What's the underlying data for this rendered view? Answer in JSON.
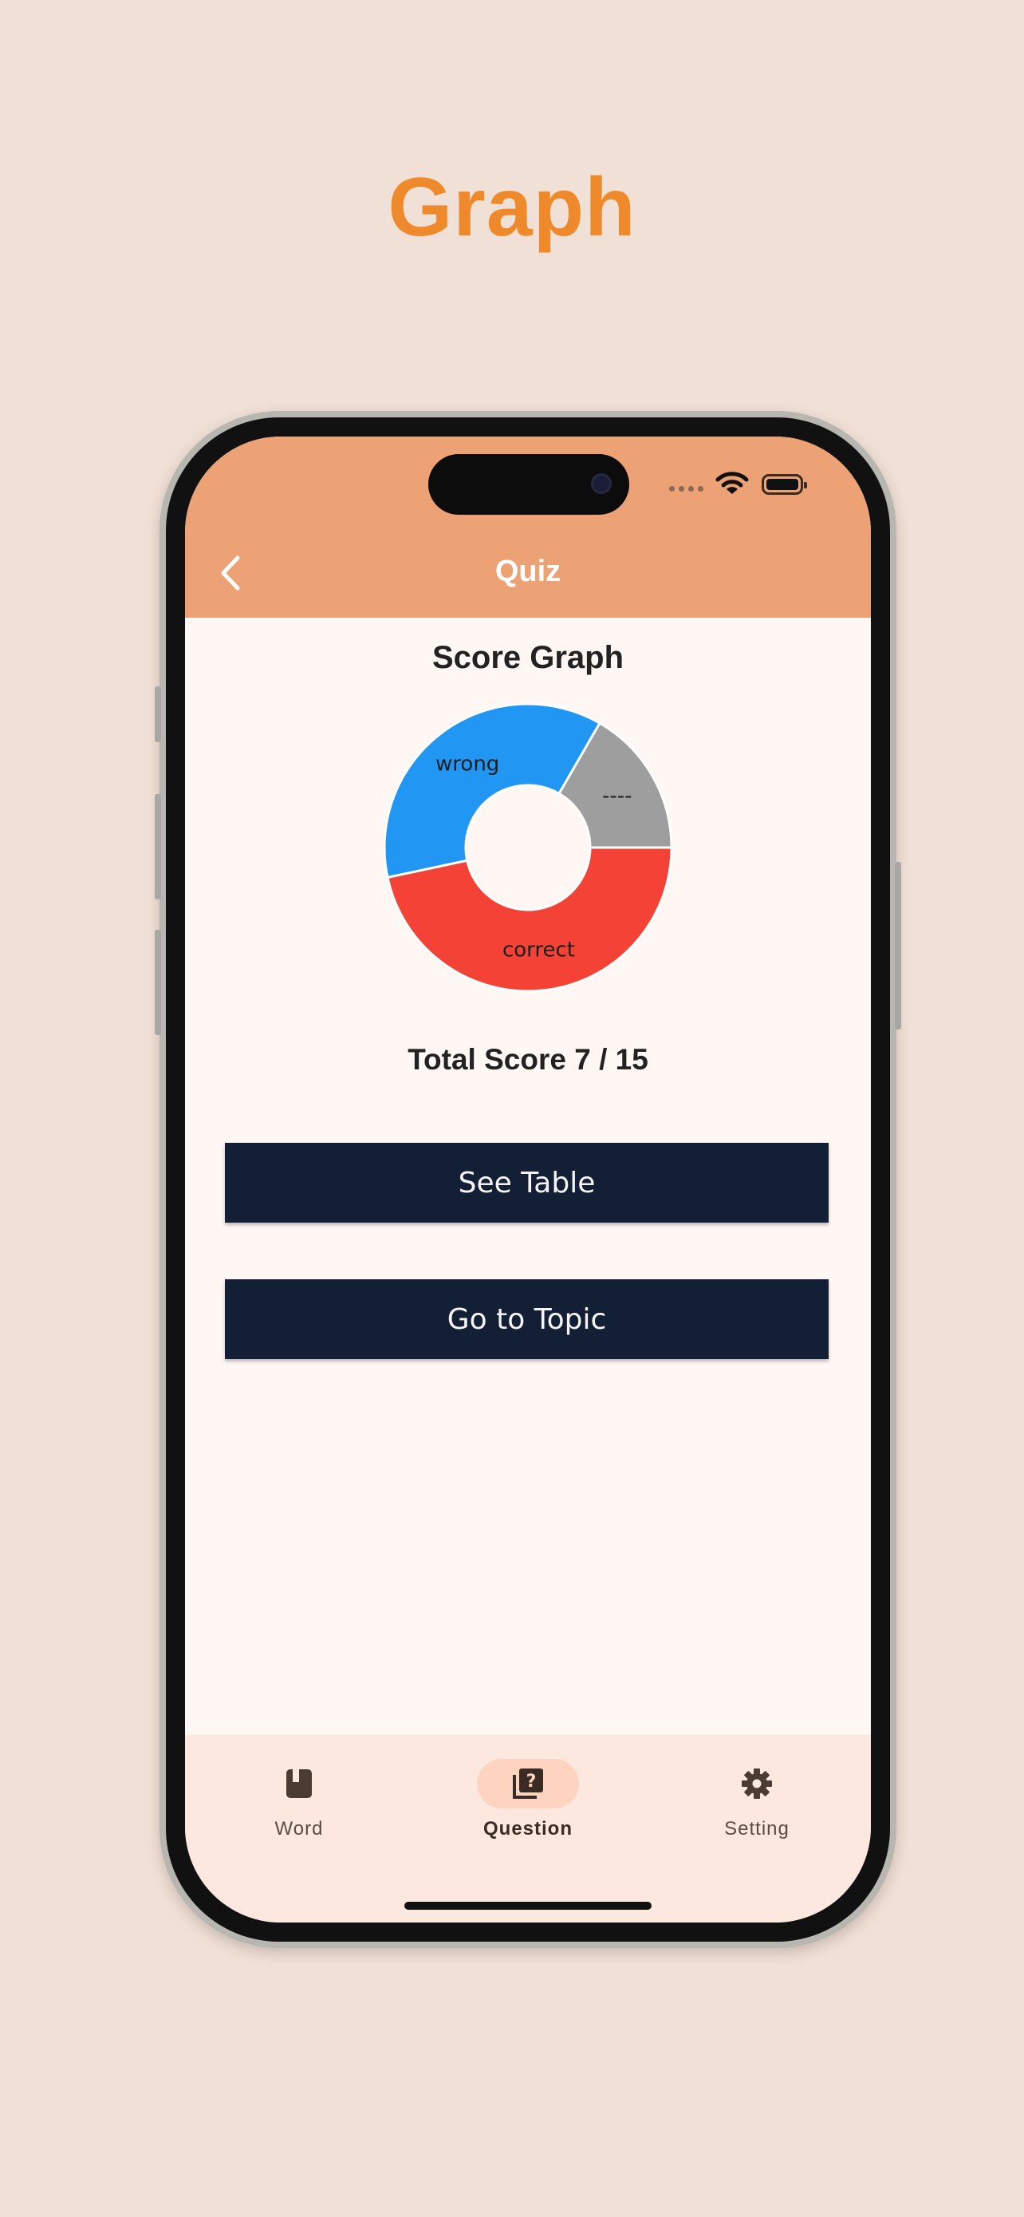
{
  "promo": {
    "title": "Graph"
  },
  "appbar": {
    "title": "Quiz"
  },
  "page": {
    "section_title": "Score Graph",
    "total_score": "Total Score 7 / 15"
  },
  "chart_data": {
    "type": "pie",
    "style": "donut",
    "labels": [
      "correct",
      "wrong",
      "----"
    ],
    "values": [
      7,
      5.5,
      2.5
    ],
    "colors": [
      "#f44336",
      "#2196f3",
      "#9e9e9e"
    ]
  },
  "buttons": {
    "see_table": "See Table",
    "go_to_topic": "Go to Topic"
  },
  "nav": {
    "items": [
      {
        "label": "Word",
        "icon": "book-icon",
        "active": false
      },
      {
        "label": "Question",
        "icon": "quiz-icon",
        "active": true
      },
      {
        "label": "Setting",
        "icon": "gear-icon",
        "active": false
      }
    ]
  },
  "colors": {
    "accent": "#ef8a2c",
    "appbar": "#eca274",
    "button": "#131f34",
    "background": "#fff7f4"
  }
}
